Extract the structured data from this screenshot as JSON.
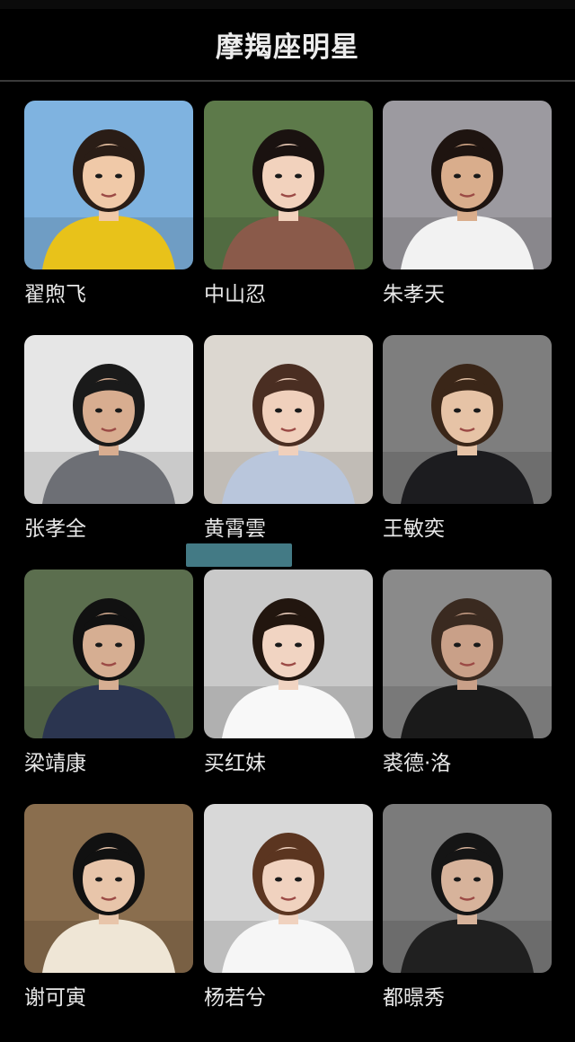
{
  "header": {
    "title": "摩羯座明星"
  },
  "stars": [
    {
      "name": "翟煦飞",
      "avatar_icon": "portrait-woman-yellow-dress",
      "bg": "#7fb3e0",
      "skin": "#f0c9a8",
      "hair": "#2a1d16",
      "clothes": "#e8c21a"
    },
    {
      "name": "中山忍",
      "avatar_icon": "portrait-woman-straw-hat",
      "bg": "#5d7a4a",
      "skin": "#f2d2bd",
      "hair": "#1a1210",
      "clothes": "#8a5a4a"
    },
    {
      "name": "朱孝天",
      "avatar_icon": "portrait-man-white-shirt",
      "bg": "#9c9aa0",
      "skin": "#d9ad8c",
      "hair": "#1e1410",
      "clothes": "#f2f2f2"
    },
    {
      "name": "张孝全",
      "avatar_icon": "portrait-man-grey-suit",
      "bg": "#e6e6e6",
      "skin": "#d8ad90",
      "hair": "#1a1a1a",
      "clothes": "#6d6f75"
    },
    {
      "name": "黄霄雲",
      "avatar_icon": "portrait-woman-blue-dress",
      "bg": "#dcd7d0",
      "skin": "#f0d0bc",
      "hair": "#4a2e22",
      "clothes": "#b9c6dc"
    },
    {
      "name": "王敏奕",
      "avatar_icon": "portrait-woman-black-suit",
      "bg": "#7e7e7e",
      "skin": "#e6c3a6",
      "hair": "#3a2618",
      "clothes": "#1c1c1f"
    },
    {
      "name": "梁靖康",
      "avatar_icon": "portrait-man-dark-jacket",
      "bg": "#5b6e4e",
      "skin": "#d6ae92",
      "hair": "#111111",
      "clothes": "#2b3550"
    },
    {
      "name": "买红妹",
      "avatar_icon": "portrait-woman-bow-tie",
      "bg": "#c9c9c9",
      "skin": "#f1d4c2",
      "hair": "#22160f",
      "clothes": "#f8f8f8"
    },
    {
      "name": "裘德·洛",
      "avatar_icon": "portrait-man-close-up",
      "bg": "#8a8a8a",
      "skin": "#c9a088",
      "hair": "#3a2a20",
      "clothes": "#1a1a1a"
    },
    {
      "name": "谢可寅",
      "avatar_icon": "portrait-woman-cream-blazer",
      "bg": "#8a6e4e",
      "skin": "#e8c5aa",
      "hair": "#111111",
      "clothes": "#efe6d6"
    },
    {
      "name": "杨若兮",
      "avatar_icon": "portrait-woman-short-hair",
      "bg": "#d8d8d8",
      "skin": "#f0d2bf",
      "hair": "#5b3520",
      "clothes": "#f6f6f6"
    },
    {
      "name": "都暻秀",
      "avatar_icon": "portrait-man-dark-shirt",
      "bg": "#7b7b7b",
      "skin": "#d7b39b",
      "hair": "#151515",
      "clothes": "#202020"
    }
  ]
}
